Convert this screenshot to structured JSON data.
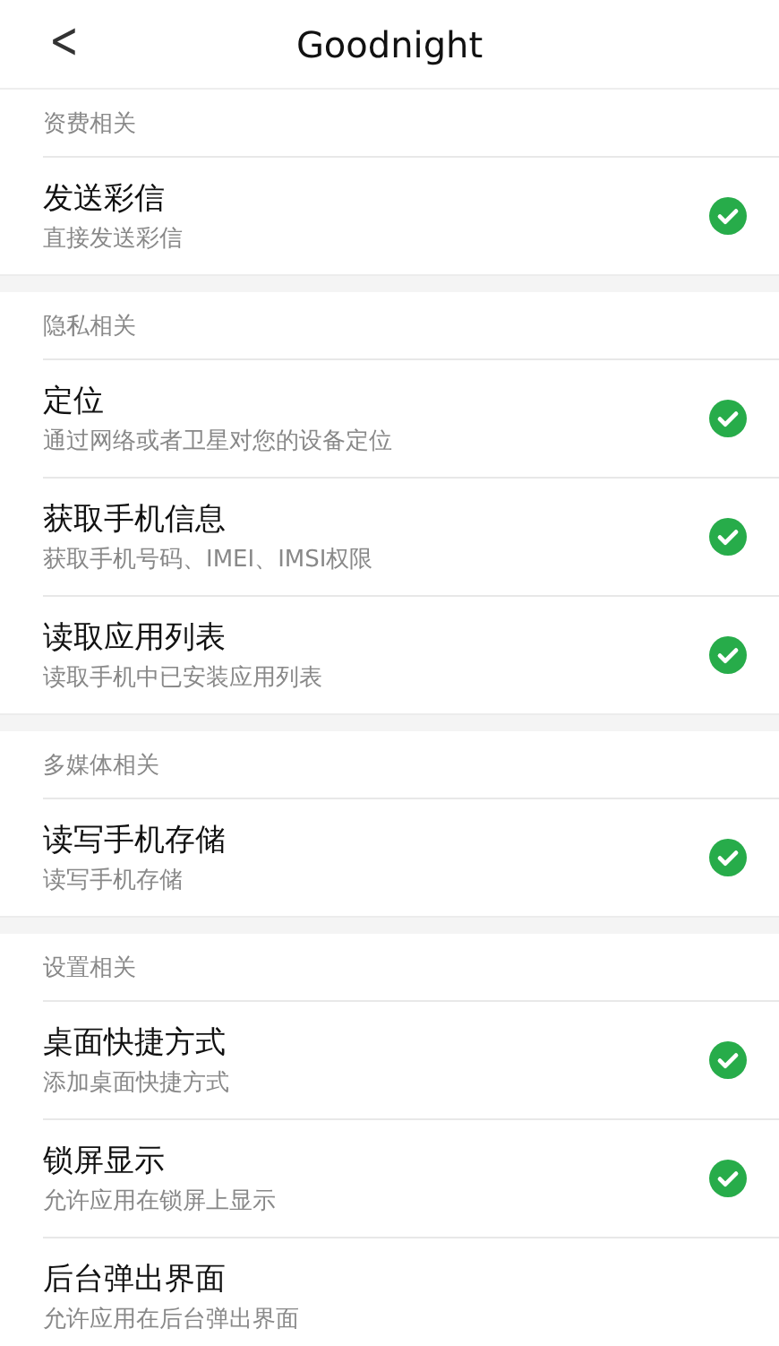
{
  "header": {
    "back": "<",
    "title": "Goodnight"
  },
  "sections": [
    {
      "title": "资费相关",
      "items": [
        {
          "title": "发送彩信",
          "subtitle": "直接发送彩信",
          "checked": true
        }
      ]
    },
    {
      "title": "隐私相关",
      "items": [
        {
          "title": "定位",
          "subtitle": "通过网络或者卫星对您的设备定位",
          "checked": true
        },
        {
          "title": "获取手机信息",
          "subtitle": "获取手机号码、IMEI、IMSI权限",
          "checked": true
        },
        {
          "title": "读取应用列表",
          "subtitle": "读取手机中已安装应用列表",
          "checked": true
        }
      ]
    },
    {
      "title": "多媒体相关",
      "items": [
        {
          "title": "读写手机存储",
          "subtitle": "读写手机存储",
          "checked": true
        }
      ]
    },
    {
      "title": "设置相关",
      "items": [
        {
          "title": "桌面快捷方式",
          "subtitle": "添加桌面快捷方式",
          "checked": true
        },
        {
          "title": "锁屏显示",
          "subtitle": "允许应用在锁屏上显示",
          "checked": true
        },
        {
          "title": "后台弹出界面",
          "subtitle": "允许应用在后台弹出界面"
        }
      ]
    }
  ]
}
